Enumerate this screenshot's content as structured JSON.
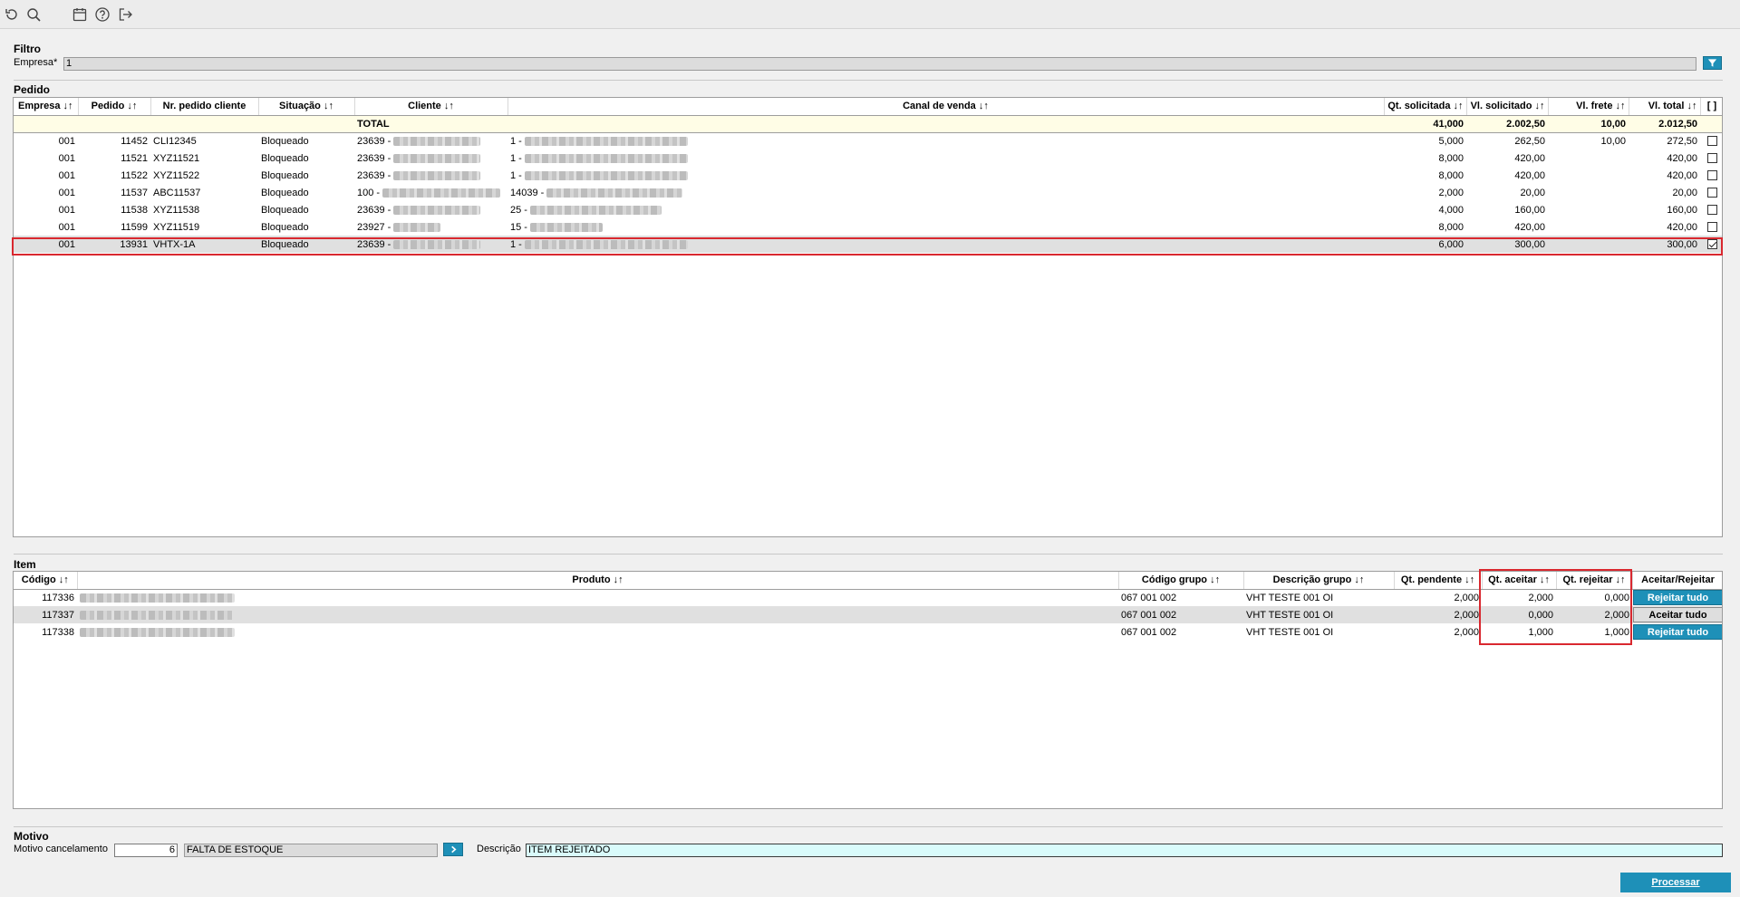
{
  "toolbar": {
    "icons": [
      "refresh-icon",
      "search-icon",
      "calendar-icon",
      "help-icon",
      "logout-icon"
    ]
  },
  "filtro": {
    "title": "Filtro",
    "empresa_label": "Empresa*",
    "empresa_value": "1"
  },
  "pedido": {
    "title": "Pedido",
    "columns": [
      "Empresa ↓↑",
      "Pedido ↓↑",
      "Nr. pedido cliente",
      "Situação ↓↑",
      "Cliente ↓↑",
      "Canal de venda ↓↑",
      "Qt. solicitada ↓↑",
      "Vl. solicitado ↓↑",
      "Vl. frete ↓↑",
      "Vl. total ↓↑",
      "[ ]"
    ],
    "total": {
      "label": "TOTAL",
      "qt_solicitada": "41,000",
      "vl_solicitado": "2.002,50",
      "vl_frete": "10,00",
      "vl_total": "2.012,50"
    },
    "rows": [
      {
        "empresa": "001",
        "pedido": "11452",
        "nr_cliente": "CLI12345",
        "situacao": "Bloqueado",
        "cliente": "23639 -",
        "canal": "1 -",
        "qt": "5,000",
        "vl_sol": "262,50",
        "frete": "10,00",
        "total": "272,50",
        "checked": false
      },
      {
        "empresa": "001",
        "pedido": "11521",
        "nr_cliente": "XYZ11521",
        "situacao": "Bloqueado",
        "cliente": "23639 -",
        "canal": "1 -",
        "qt": "8,000",
        "vl_sol": "420,00",
        "frete": "",
        "total": "420,00",
        "checked": false
      },
      {
        "empresa": "001",
        "pedido": "11522",
        "nr_cliente": "XYZ11522",
        "situacao": "Bloqueado",
        "cliente": "23639 -",
        "canal": "1 -",
        "qt": "8,000",
        "vl_sol": "420,00",
        "frete": "",
        "total": "420,00",
        "checked": false
      },
      {
        "empresa": "001",
        "pedido": "11537",
        "nr_cliente": "ABC11537",
        "situacao": "Bloqueado",
        "cliente": "100 -",
        "canal": "14039 -",
        "qt": "2,000",
        "vl_sol": "20,00",
        "frete": "",
        "total": "20,00",
        "checked": false
      },
      {
        "empresa": "001",
        "pedido": "11538",
        "nr_cliente": "XYZ11538",
        "situacao": "Bloqueado",
        "cliente": "23639 -",
        "canal": "25 -",
        "qt": "4,000",
        "vl_sol": "160,00",
        "frete": "",
        "total": "160,00",
        "checked": false
      },
      {
        "empresa": "001",
        "pedido": "11599",
        "nr_cliente": "XYZ11519",
        "situacao": "Bloqueado",
        "cliente": "23927 -",
        "canal": "15 -",
        "qt": "8,000",
        "vl_sol": "420,00",
        "frete": "",
        "total": "420,00",
        "checked": false
      },
      {
        "empresa": "001",
        "pedido": "13931",
        "nr_cliente": "VHTX-1A",
        "situacao": "Bloqueado",
        "cliente": "23639 -",
        "canal": "1 -",
        "qt": "6,000",
        "vl_sol": "300,00",
        "frete": "",
        "total": "300,00",
        "checked": true
      }
    ]
  },
  "item": {
    "title": "Item",
    "columns": [
      "Código ↓↑",
      "Produto ↓↑",
      "Código grupo ↓↑",
      "Descrição grupo ↓↑",
      "Qt. pendente ↓↑",
      "Qt. aceitar ↓↑",
      "Qt. rejeitar ↓↑",
      "Aceitar/Rejeitar"
    ],
    "rows": [
      {
        "codigo": "117336",
        "codigo_grupo": "067 001 002",
        "descricao_grupo": "VHT TESTE 001 OI",
        "qt_pendente": "2,000",
        "qt_aceitar": "2,000",
        "qt_rejeitar": "0,000",
        "action": "Rejeitar tudo"
      },
      {
        "codigo": "117337",
        "codigo_grupo": "067 001 002",
        "descricao_grupo": "VHT TESTE 001 OI",
        "qt_pendente": "2,000",
        "qt_aceitar": "0,000",
        "qt_rejeitar": "2,000",
        "action": "Aceitar tudo"
      },
      {
        "codigo": "117338",
        "codigo_grupo": "067 001 002",
        "descricao_grupo": "VHT TESTE 001 OI",
        "qt_pendente": "2,000",
        "qt_aceitar": "1,000",
        "qt_rejeitar": "1,000",
        "action": "Rejeitar tudo"
      }
    ]
  },
  "motivo": {
    "title": "Motivo",
    "cancel_label": "Motivo cancelamento",
    "cancel_code": "6",
    "cancel_desc": "FALTA DE ESTOQUE",
    "descricao_label": "Descrição",
    "descricao_value": "ITEM REJEITADO"
  },
  "processar_label": "Processar",
  "colors": {
    "accent": "#1e90b8",
    "highlight": "#d9282f",
    "total_row": "#fffde6"
  }
}
